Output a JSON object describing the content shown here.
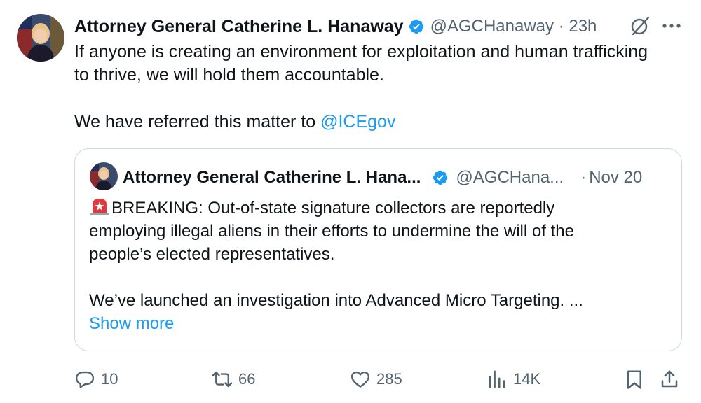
{
  "tweet": {
    "author_name": "Attorney General Catherine L. Hanaway",
    "handle_time": "@AGCHanaway · 23h",
    "text_line1": "If anyone is creating an environment for exploitation and human trafficking",
    "text_line2": "to thrive, we will hold them accountable.",
    "text_line3_prefix": "We have referred this matter to ",
    "text_line3_mention": "@ICEgov",
    "verified_color": "#1d9bf0",
    "icons": {
      "verified": "verified-badge-icon",
      "grok": "grok-icon",
      "more": "more-icon"
    }
  },
  "quote": {
    "author_name": "Attorney General Catherine L. Hana...",
    "handle": "@AGCHana...",
    "dot": "·",
    "date": "Nov 20",
    "line1_text": "BREAKING: Out-of-state signature collectors are reportedly",
    "line2": "employing illegal aliens in their efforts to undermine the will of the",
    "line3": "people’s elected representatives.",
    "line4": "We’ve launched an investigation into Advanced Micro Targeting. ...",
    "show_more": "Show more",
    "emoji": "siren-emoji"
  },
  "actions": {
    "replies": "10",
    "reposts": "66",
    "likes": "285",
    "views": "14K",
    "icons": [
      "reply-icon",
      "repost-icon",
      "like-icon",
      "views-icon",
      "bookmark-icon",
      "share-icon"
    ]
  },
  "colors": {
    "text": "#0f1419",
    "secondary": "#536471",
    "accent": "#1d9bf0",
    "border": "#cfd9de"
  }
}
